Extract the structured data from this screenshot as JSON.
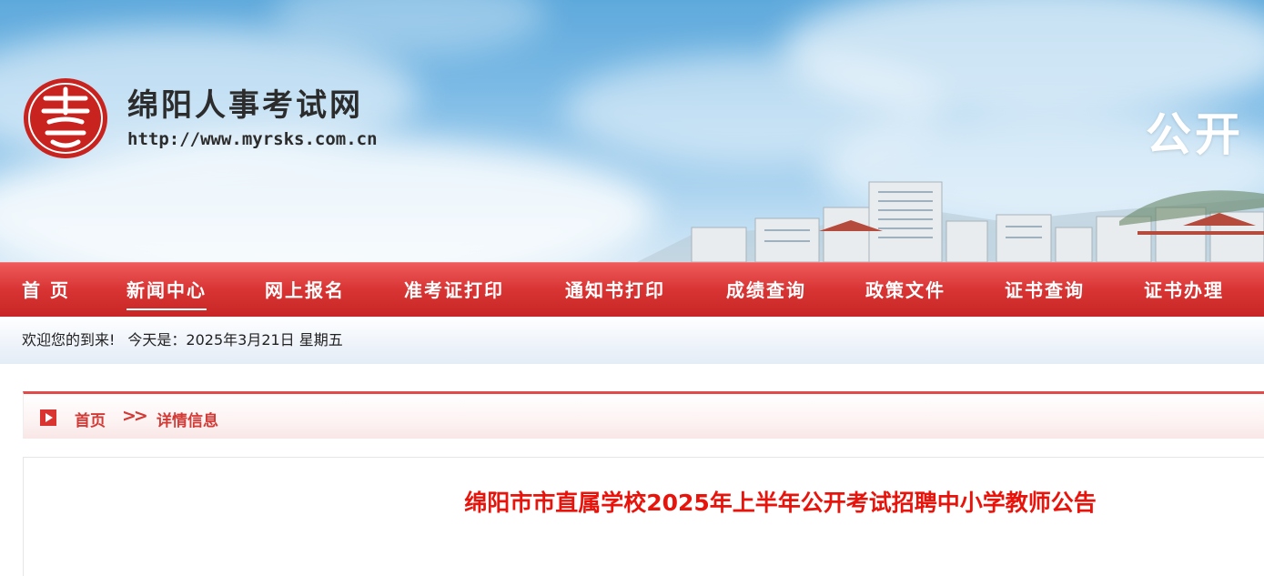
{
  "header": {
    "site_title": "绵阳人事考试网",
    "site_url": "http://www.myrsks.com.cn",
    "slogan": "公开",
    "logo_icon": "seal-logo-icon"
  },
  "nav": {
    "items": [
      {
        "label": "首 页"
      },
      {
        "label": "新闻中心",
        "active": true
      },
      {
        "label": "网上报名"
      },
      {
        "label": "准考证打印"
      },
      {
        "label": "通知书打印"
      },
      {
        "label": "成绩查询"
      },
      {
        "label": "政策文件"
      },
      {
        "label": "证书查询"
      },
      {
        "label": "证书办理"
      }
    ]
  },
  "welcome": {
    "greeting": "欢迎您的到来!",
    "date_text": "今天是：2025年3月21日 星期五"
  },
  "breadcrumb": {
    "home": "首页",
    "separator": ">>",
    "current": "详情信息"
  },
  "article": {
    "title": "绵阳市市直属学校2025年上半年公开考试招聘中小学教师公告"
  },
  "colors": {
    "nav_red": "#d83434",
    "title_red": "#e8140c",
    "crumb_red": "#d23a36",
    "seal_red": "#c8231f"
  }
}
